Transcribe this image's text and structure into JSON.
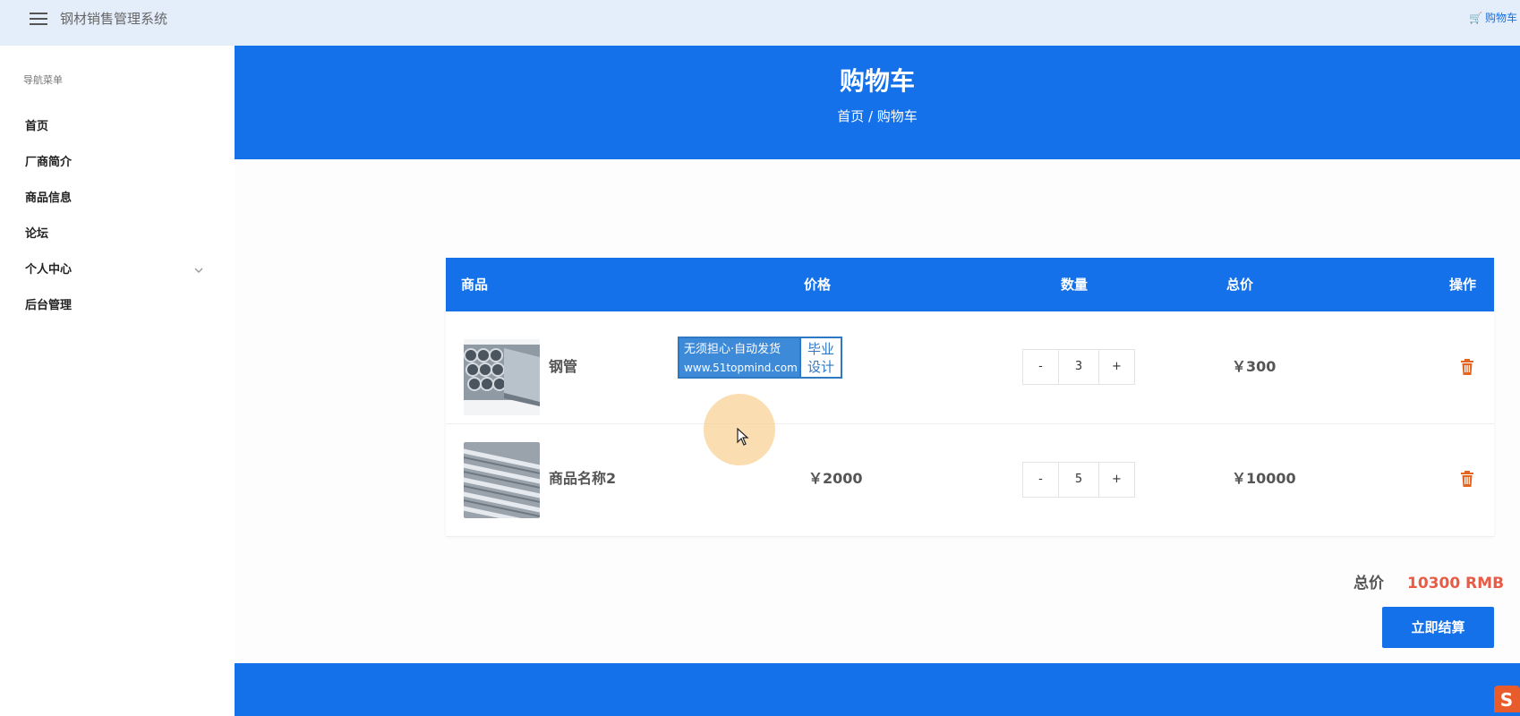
{
  "header": {
    "app_title": "钢材销售管理系统",
    "cart_link": "购物车",
    "cart_icon": "cart-icon",
    "menu_icon": "hamburger-icon"
  },
  "sidebar": {
    "caption": "导航菜单",
    "items": [
      {
        "label": "首页"
      },
      {
        "label": "厂商简介"
      },
      {
        "label": "商品信息"
      },
      {
        "label": "论坛"
      },
      {
        "label": "个人中心",
        "has_submenu": true
      },
      {
        "label": "后台管理"
      }
    ]
  },
  "hero": {
    "title": "购物车",
    "breadcrumb": {
      "home": "首页",
      "separator": " / ",
      "current": "购物车"
    }
  },
  "table": {
    "columns": [
      "商品",
      "价格",
      "数量",
      "总价",
      "操作"
    ],
    "rows": [
      {
        "name": "钢管",
        "price": "",
        "quantity": "3",
        "subtotal": "￥300",
        "minus": "-",
        "plus": "+"
      },
      {
        "name": "商品名称2",
        "price": "￥2000",
        "quantity": "5",
        "subtotal": "￥10000",
        "minus": "-",
        "plus": "+"
      }
    ]
  },
  "watermark": {
    "line1": "无须担心·自动发货",
    "line2": "www.51topmind.com",
    "badge_line1": "毕业",
    "badge_line2": "设计"
  },
  "summary": {
    "total_label": "总价",
    "total_value": "10300 RMB",
    "checkout_label": "立即结算"
  },
  "colors": {
    "primary": "#1571ea",
    "header_bg": "#e4eefb",
    "total_accent": "#e95b45",
    "delete": "#e3651f"
  }
}
